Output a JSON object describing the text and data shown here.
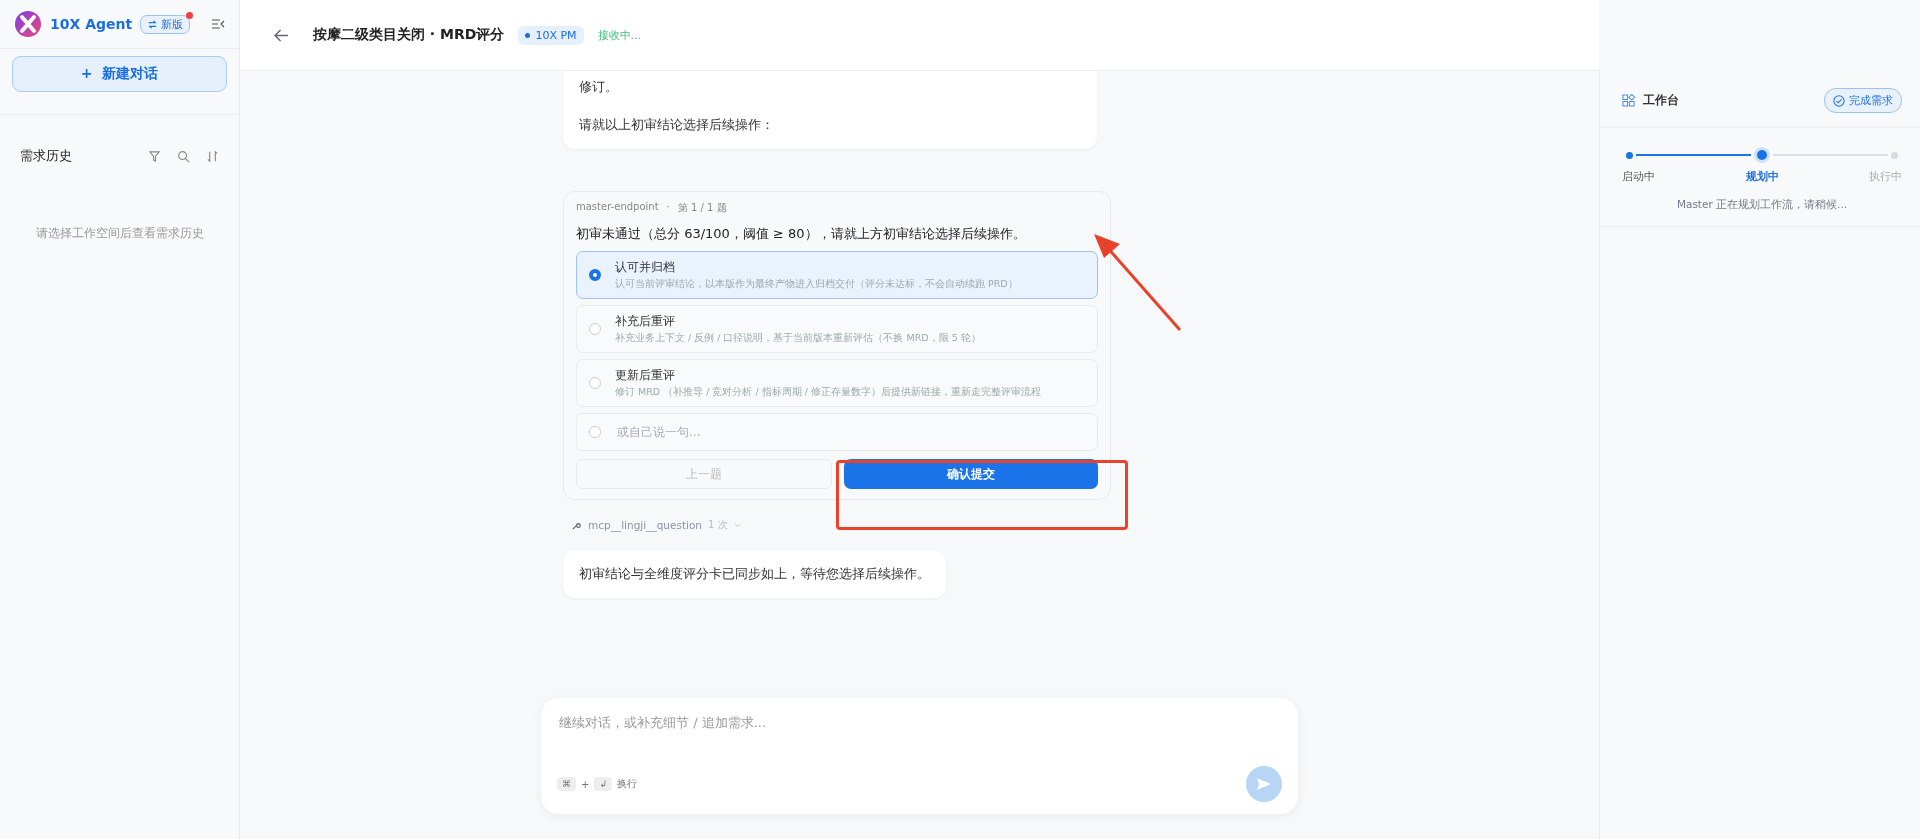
{
  "sidebar": {
    "brand": "10X Agent",
    "version_badge": {
      "label": "新版",
      "has_dot": true
    },
    "new_chat_button": {
      "icon": "+",
      "label": "新建对话"
    },
    "history": {
      "title": "需求历史",
      "empty_text": "请选择工作空间后查看需求历史"
    }
  },
  "header": {
    "title": "按摩二级类目关闭 · MRD评分",
    "agent_badge": "10X PM",
    "status": "接收中..."
  },
  "messages": [
    {
      "kind": "bubble",
      "paragraphs": [
        "修订。",
        "请就以上初审结论选择后续操作："
      ]
    },
    {
      "kind": "question",
      "source": "master-endpoint",
      "separator": "·",
      "position": "第 1 / 1 题",
      "question": "初审未通过（总分 63/100，阈值 ≥ 80），请就上方初审结论选择后续操作。",
      "options": [
        {
          "kind": "choice",
          "title": "认可并归档",
          "description": "认可当前评审结论，以本版作为最终产物进入归档交付（评分未达标，不会自动续跑 PRD）",
          "selected": true
        },
        {
          "kind": "choice",
          "title": "补充后重评",
          "description": "补充业务上下文 / 反例 / 口径说明，基于当前版本重新评估（不换 MRD，限 5 轮）",
          "selected": false
        },
        {
          "kind": "choice",
          "title": "更新后重评",
          "description": "修订 MRD （补推导 / 竞对分析 / 指标周期 / 修正存量数字）后提供新链接，重新走完整评审流程",
          "selected": false
        },
        {
          "kind": "custom",
          "placeholder": "或自己说一句...",
          "selected": false
        }
      ],
      "prev_button": {
        "label": "上一题",
        "disabled": true
      },
      "submit_button": "确认提交"
    },
    {
      "kind": "tool",
      "name": "mcp__lingji__question",
      "count": "1 次"
    },
    {
      "kind": "bubble",
      "paragraphs": [
        "初审结论与全维度评分卡已同步如上，等待您选择后续操作。"
      ]
    }
  ],
  "composer": {
    "placeholder": "继续对话，或补充细节 / 追加需求...",
    "hint_keys": [
      "⌘",
      "↲"
    ],
    "hint_plus": "+",
    "hint_text": "换行"
  },
  "workbench": {
    "title": "工作台",
    "complete_button": "完成需求",
    "steps": [
      {
        "label": "启动中",
        "done": true,
        "current": false
      },
      {
        "label": "规划中",
        "done": false,
        "current": true
      },
      {
        "label": "执行中",
        "done": false,
        "current": false
      }
    ],
    "status_text": "Master 正在规划工作流，请稍候..."
  }
}
